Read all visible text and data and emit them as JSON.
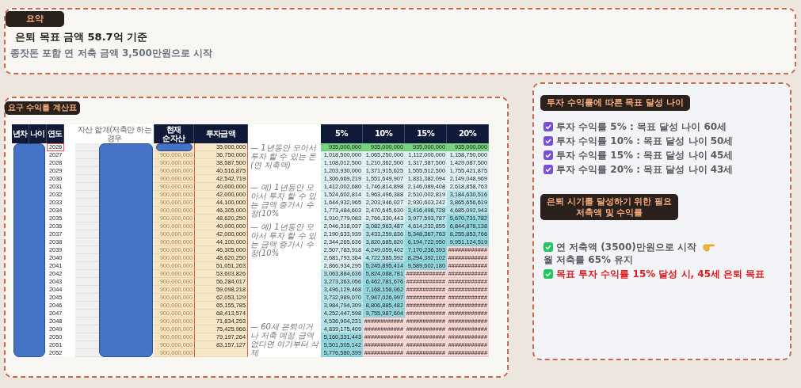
{
  "summary": {
    "tag": "요약",
    "title": "은퇴 목표 금액 58.7억 기준",
    "subtitle": "종잣돈 포함 연 저축 금액 3,500만원으로 시작"
  },
  "calc": {
    "tag": "요구 수익률 계산표",
    "columns": [
      {
        "label": "년차"
      },
      {
        "label": "나이"
      },
      {
        "label": "연도"
      },
      {
        "label": "자산 합계(저축만 하는 경우"
      },
      {
        "label": "현재 순자산"
      },
      {
        "label": "투자금액"
      }
    ],
    "return_columns": [
      {
        "label": "5%"
      },
      {
        "label": "10%"
      },
      {
        "label": "15%"
      },
      {
        "label": "20%"
      }
    ],
    "rows": [
      {
        "year": "2026",
        "investment": "35,000,000",
        "note": "— 1년동안 모아서 투자 할 수 있는 돈 (연 저축액)",
        "returns": [
          {
            "value": "935,000,000",
            "color": "#79d27f"
          },
          {
            "value": "935,000,000",
            "color": "#79d27f"
          },
          {
            "value": "935,000,000",
            "color": "#79d27f"
          },
          {
            "value": "935,000,000",
            "color": "#79d27f"
          }
        ]
      },
      {
        "year": "2027",
        "net_asset": "900,000,000",
        "investment": "36,750,000",
        "returns": [
          {
            "value": "1,018,500,000",
            "color": "#dff2f4"
          },
          {
            "value": "1,065,250,000",
            "color": "#dff2f4"
          },
          {
            "value": "1,112,000,000",
            "color": "#dff2f4"
          },
          {
            "value": "1,158,750,000",
            "color": "#dff2f4"
          }
        ]
      },
      {
        "year": "2028",
        "net_asset": "900,000,000",
        "investment": "38,587,500",
        "returns": [
          {
            "value": "1,108,012,500",
            "color": "#dff2f4"
          },
          {
            "value": "1,210,362,500",
            "color": "#dff2f4"
          },
          {
            "value": "1,317,387,500",
            "color": "#dff2f4"
          },
          {
            "value": "1,429,087,500",
            "color": "#dff2f4"
          }
        ]
      },
      {
        "year": "2029",
        "net_asset": "900,000,000",
        "investment": "40,516,875",
        "returns": [
          {
            "value": "1,203,930,000",
            "color": "#dff2f4"
          },
          {
            "value": "1,371,915,625",
            "color": "#dff2f4"
          },
          {
            "value": "1,555,512,500",
            "color": "#dff2f4"
          },
          {
            "value": "1,755,421,875",
            "color": "#dff2f4"
          }
        ]
      },
      {
        "year": "2030",
        "net_asset": "900,000,000",
        "investment": "42,542,719",
        "returns": [
          {
            "value": "1,306,669,219",
            "color": "#dff2f4"
          },
          {
            "value": "1,551,649,907",
            "color": "#dff2f4"
          },
          {
            "value": "1,831,382,094",
            "color": "#dff2f4"
          },
          {
            "value": "2,149,048,969",
            "color": "#dff2f4"
          }
        ]
      },
      {
        "year": "2031",
        "net_asset": "900,000,000",
        "investment": "40,000,000",
        "note": "— 예) 1년동안 모아서 투자 할 수 있는 금액 증가시 수정(10%",
        "returns": [
          {
            "value": "1,412,002,680",
            "color": "#dff2f4"
          },
          {
            "value": "1,746,814,898",
            "color": "#dff2f4"
          },
          {
            "value": "2,146,089,408",
            "color": "#dff2f4"
          },
          {
            "value": "2,618,858,763",
            "color": "#dff2f4"
          }
        ]
      },
      {
        "year": "2032",
        "net_asset": "900,000,000",
        "investment": "42,000,000",
        "returns": [
          {
            "value": "1,524,602,814",
            "color": "#dff2f4"
          },
          {
            "value": "1,963,496,388",
            "color": "#dff2f4"
          },
          {
            "value": "2,510,002,819",
            "color": "#dff2f4"
          },
          {
            "value": "3,184,630,516",
            "color": "#b8e5ea"
          }
        ]
      },
      {
        "year": "2033",
        "net_asset": "900,000,000",
        "investment": "44,100,000",
        "returns": [
          {
            "value": "1,644,932,965",
            "color": "#dff2f4"
          },
          {
            "value": "2,203,946,027",
            "color": "#dff2f4"
          },
          {
            "value": "2,930,603,242",
            "color": "#dff2f4"
          },
          {
            "value": "3,865,656,619",
            "color": "#b8e5ea"
          }
        ]
      },
      {
        "year": "2034",
        "net_asset": "900,000,000",
        "investment": "46,305,000",
        "returns": [
          {
            "value": "1,773,484,603",
            "color": "#dff2f4"
          },
          {
            "value": "2,470,645,630",
            "color": "#dff2f4"
          },
          {
            "value": "3,416,498,728",
            "color": "#b8e5ea"
          },
          {
            "value": "4,685,092,943",
            "color": "#b8e5ea"
          }
        ]
      },
      {
        "year": "2035",
        "net_asset": "900,000,000",
        "investment": "48,620,250",
        "returns": [
          {
            "value": "1,910,779,083",
            "color": "#dff2f4"
          },
          {
            "value": "2,766,330,443",
            "color": "#dff2f4"
          },
          {
            "value": "3,977,593,787",
            "color": "#b8e5ea"
          },
          {
            "value": "5,670,731,782",
            "color": "#93d6de"
          }
        ]
      },
      {
        "year": "2036",
        "net_asset": "900,000,000",
        "investment": "40,000,000",
        "note": "— 예) 1년동안 모아서 투자 할 수 있는 금액 증가시 수정(10%",
        "returns": [
          {
            "value": "2,046,318,037",
            "color": "#dff2f4"
          },
          {
            "value": "3,082,963,487",
            "color": "#b8e5ea"
          },
          {
            "value": "4,614,232,855",
            "color": "#b8e5ea"
          },
          {
            "value": "6,844,878,138",
            "color": "#93d6de"
          }
        ]
      },
      {
        "year": "2037",
        "net_asset": "900,000,000",
        "investment": "42,000,000",
        "returns": [
          {
            "value": "2,190,633,939",
            "color": "#dff2f4"
          },
          {
            "value": "3,433,259,836",
            "color": "#b8e5ea"
          },
          {
            "value": "5,348,367,763",
            "color": "#93d6de"
          },
          {
            "value": "8,255,853,766",
            "color": "#93d6de"
          }
        ]
      },
      {
        "year": "2038",
        "net_asset": "900,000,000",
        "investment": "44,100,000",
        "returns": [
          {
            "value": "2,344,265,636",
            "color": "#dff2f4"
          },
          {
            "value": "3,820,685,820",
            "color": "#b8e5ea"
          },
          {
            "value": "6,194,722,950",
            "color": "#93d6de"
          },
          {
            "value": "9,951,124,519",
            "color": "#93d6de"
          }
        ]
      },
      {
        "year": "2039",
        "net_asset": "900,000,000",
        "investment": "46,305,000",
        "returns": [
          {
            "value": "2,507,783,918",
            "color": "#dff2f4"
          },
          {
            "value": "4,249,059,402",
            "color": "#b8e5ea"
          },
          {
            "value": "7,170,236,393",
            "color": "#93d6de"
          },
          {
            "value": "############",
            "color": "#f8d8d5"
          }
        ]
      },
      {
        "year": "2040",
        "net_asset": "900,000,000",
        "investment": "48,620,250",
        "returns": [
          {
            "value": "2,681,793,364",
            "color": "#dff2f4"
          },
          {
            "value": "4,722,585,592",
            "color": "#b8e5ea"
          },
          {
            "value": "8,294,392,102",
            "color": "#93d6de"
          },
          {
            "value": "############",
            "color": "#f8d8d5"
          }
        ]
      },
      {
        "year": "2041",
        "net_asset": "900,000,000",
        "investment": "51,051,263",
        "returns": [
          {
            "value": "2,866,934,295",
            "color": "#dff2f4"
          },
          {
            "value": "5,245,895,414",
            "color": "#93d6de"
          },
          {
            "value": "9,589,602,180",
            "color": "#93d6de"
          },
          {
            "value": "############",
            "color": "#f8d8d5"
          }
        ]
      },
      {
        "year": "2042",
        "net_asset": "900,000,000",
        "investment": "53,603,826",
        "returns": [
          {
            "value": "3,063,884,636",
            "color": "#b8e5ea"
          },
          {
            "value": "5,824,088,781",
            "color": "#93d6de"
          },
          {
            "value": "############",
            "color": "#f8d8d5"
          },
          {
            "value": "############",
            "color": "#f8d8d5"
          }
        ]
      },
      {
        "year": "2043",
        "net_asset": "900,000,000",
        "investment": "56,284,017",
        "returns": [
          {
            "value": "3,273,363,056",
            "color": "#b8e5ea"
          },
          {
            "value": "6,462,781,676",
            "color": "#93d6de"
          },
          {
            "value": "############",
            "color": "#f8d8d5"
          },
          {
            "value": "############",
            "color": "#f8d8d5"
          }
        ]
      },
      {
        "year": "2044",
        "net_asset": "900,000,000",
        "investment": "59,098,218",
        "returns": [
          {
            "value": "3,496,129,468",
            "color": "#b8e5ea"
          },
          {
            "value": "7,168,158,062",
            "color": "#93d6de"
          },
          {
            "value": "############",
            "color": "#f8d8d5"
          },
          {
            "value": "############",
            "color": "#f8d8d5"
          }
        ]
      },
      {
        "year": "2045",
        "net_asset": "900,000,000",
        "investment": "62,053,129",
        "returns": [
          {
            "value": "3,732,989,070",
            "color": "#b8e5ea"
          },
          {
            "value": "7,947,026,997",
            "color": "#93d6de"
          },
          {
            "value": "############",
            "color": "#f8d8d5"
          },
          {
            "value": "############",
            "color": "#f8d8d5"
          }
        ]
      },
      {
        "year": "2046",
        "net_asset": "900,000,000",
        "investment": "65,155,785",
        "returns": [
          {
            "value": "3,984,794,309",
            "color": "#b8e5ea"
          },
          {
            "value": "8,806,885,482",
            "color": "#93d6de"
          },
          {
            "value": "############",
            "color": "#f8d8d5"
          },
          {
            "value": "############",
            "color": "#f8d8d5"
          }
        ]
      },
      {
        "year": "2047",
        "net_asset": "900,000,000",
        "investment": "68,413,574",
        "returns": [
          {
            "value": "4,252,447,598",
            "color": "#b8e5ea"
          },
          {
            "value": "9,755,987,604",
            "color": "#93d6de"
          },
          {
            "value": "############",
            "color": "#f8d8d5"
          },
          {
            "value": "############",
            "color": "#f8d8d5"
          }
        ]
      },
      {
        "year": "2048",
        "net_asset": "900,000,000",
        "investment": "71,834,253",
        "returns": [
          {
            "value": "4,536,904,231",
            "color": "#b8e5ea"
          },
          {
            "value": "############",
            "color": "#f8d8d5"
          },
          {
            "value": "############",
            "color": "#f8d8d5"
          },
          {
            "value": "############",
            "color": "#f8d8d5"
          }
        ]
      },
      {
        "year": "2049",
        "net_asset": "900,000,000",
        "investment": "75,425,966",
        "returns": [
          {
            "value": "4,839,175,409",
            "color": "#b8e5ea"
          },
          {
            "value": "############",
            "color": "#f8d8d5"
          },
          {
            "value": "############",
            "color": "#f8d8d5"
          },
          {
            "value": "############",
            "color": "#f8d8d5"
          }
        ]
      },
      {
        "year": "2050",
        "net_asset": "900,000,000",
        "investment": "79,197,264",
        "returns": [
          {
            "value": "5,160,331,443",
            "color": "#93d6de"
          },
          {
            "value": "############",
            "color": "#f8d8d5"
          },
          {
            "value": "############",
            "color": "#f8d8d5"
          },
          {
            "value": "############",
            "color": "#f8d8d5"
          }
        ]
      },
      {
        "year": "2051",
        "net_asset": "900,000,000",
        "investment": "83,157,127",
        "returns": [
          {
            "value": "5,501,505,142",
            "color": "#93d6de"
          },
          {
            "value": "############",
            "color": "#f8d8d5"
          },
          {
            "value": "############",
            "color": "#f8d8d5"
          },
          {
            "value": "############",
            "color": "#f8d8d5"
          }
        ]
      },
      {
        "year": "2052",
        "net_asset": "900,000,000",
        "note": "— 60세 은퇴이거나 저축 예정 금액 없다면 여기부터 삭제",
        "returns": [
          {
            "value": "5,776,580,399",
            "color": "#93d6de"
          },
          {
            "value": "############",
            "color": "#f8d8d5"
          },
          {
            "value": "############",
            "color": "#f8d8d5"
          },
          {
            "value": "############",
            "color": "#f8d8d5"
          }
        ]
      }
    ]
  },
  "targets": {
    "tag": "투자 수익률에 따른 목표 달성 나이",
    "items": [
      {
        "text": "투자 수익률 5% : 목표 달성 나이 60세",
        "checked": true
      },
      {
        "text": "투자 수익률 10% : 목표 달성 나이 50세",
        "checked": true
      },
      {
        "text": "투자 수익률 15% : 목표 달성 나이 45세",
        "checked": true
      },
      {
        "text": "투자 수익률 20% : 목표 달성 나이 43세",
        "checked": true
      }
    ]
  },
  "needs": {
    "tag": [
      "은퇴 시기를 달성하기 위한 필요",
      "저축액 및 수익률"
    ],
    "items": [
      {
        "parts": [
          "연 저축액 (3500)만원으로 시작",
          "월 저축률 65% 유지"
        ],
        "checked": true,
        "emphasis": false
      },
      {
        "parts": [
          "목표 투자 수익률 15% 달성 시, 45세 은퇴 목표"
        ],
        "checked": true,
        "emphasis": true
      }
    ]
  }
}
